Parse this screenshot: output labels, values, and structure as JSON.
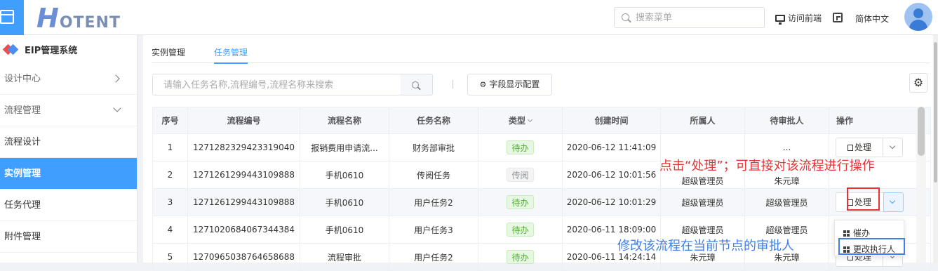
{
  "header": {
    "logo_h": "H",
    "logo_rest": "OTENT",
    "search_placeholder": "搜索菜单",
    "visit_front": "访问前端",
    "language": "简体中文"
  },
  "sidebar": {
    "system_title": "EIP管理系统",
    "items": [
      {
        "label": "设计中心",
        "type": "group",
        "expanded": false
      },
      {
        "label": "流程管理",
        "type": "group",
        "expanded": true
      },
      {
        "label": "流程设计",
        "type": "item"
      },
      {
        "label": "实例管理",
        "type": "item",
        "active": true
      },
      {
        "label": "任务代理",
        "type": "item"
      },
      {
        "label": "附件管理",
        "type": "item"
      }
    ]
  },
  "tabs": [
    {
      "label": "实例管理",
      "active": false
    },
    {
      "label": "任务管理",
      "active": true
    }
  ],
  "toolbar": {
    "search_placeholder": "请输入任务名称,流程编号,流程名称来搜索",
    "config_label": "字段显示配置"
  },
  "table": {
    "headers": [
      "序号",
      "流程编号",
      "流程名称",
      "任务名称",
      "类型",
      "创建时间",
      "所属人",
      "待审批人",
      "操作"
    ],
    "rows": [
      {
        "no": "1",
        "code": "1271282329423319040",
        "flow": "报销费用申请流...",
        "task": "财务部审批",
        "type": "待办",
        "type_kind": "todo",
        "created": "2020-06-12 11:41:09",
        "owner": "",
        "approver": "...",
        "op": "处理"
      },
      {
        "no": "2",
        "code": "1271261299443109888",
        "flow": "手机0610",
        "task": "传阅任务",
        "type": "传阅",
        "type_kind": "read",
        "created": "2020-06-12 10:01:56",
        "owner": "超级管理员",
        "approver": "朱元璋",
        "op": ""
      },
      {
        "no": "3",
        "code": "1271261299443109888",
        "flow": "手机0610",
        "task": "用户任务2",
        "type": "待办",
        "type_kind": "todo",
        "created": "2020-06-12 10:01:29",
        "owner": "超级管理员",
        "approver": "超级管理员",
        "op": "处理"
      },
      {
        "no": "4",
        "code": "1271020684067344384",
        "flow": "手机0610",
        "task": "用户任务3",
        "type": "待办",
        "type_kind": "todo",
        "created": "2020-06-11 18:09:00",
        "owner": "超级管理员",
        "approver": "超级管理员",
        "op": ""
      },
      {
        "no": "5",
        "code": "1270965038764658688",
        "flow": "流程审批",
        "task": "用户任务2",
        "type": "待办",
        "type_kind": "todo",
        "created": "2020-06-11 14:24:14",
        "owner": "朱元璋",
        "approver": "朱元璋",
        "op": "处理"
      }
    ]
  },
  "dropdown": {
    "items": [
      "催办",
      "更改执行人"
    ]
  },
  "annotations": {
    "red": "点击“处理”；可直接对该流程进行操作",
    "blue": "修改该流程在当前节点的审批人"
  },
  "colors": {
    "primary": "#409eff",
    "todo_green": "#52b132",
    "annotation_red": "#e63333",
    "annotation_blue": "#3f7fe6"
  }
}
